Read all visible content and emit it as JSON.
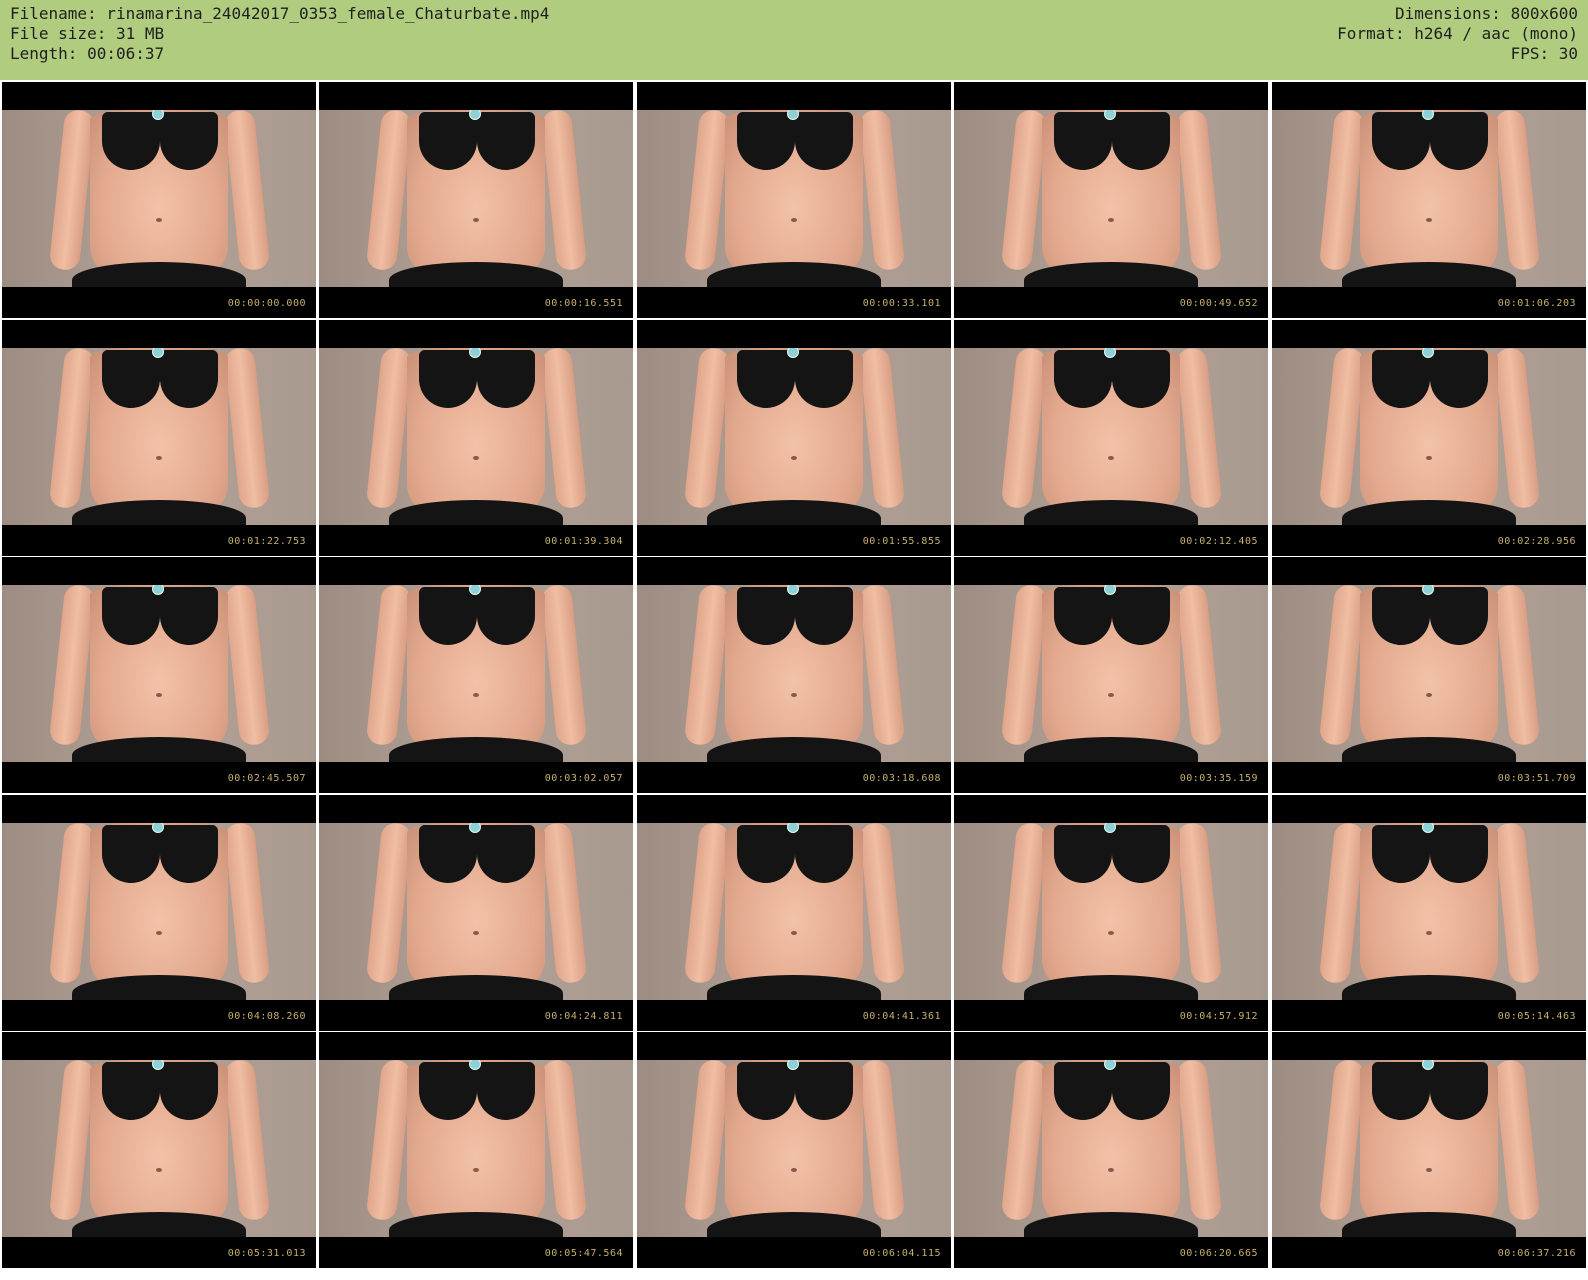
{
  "header": {
    "filename": "Filename: rinamarina_24042017_0353_female_Chaturbate.mp4",
    "filesize": "File size: 31 MB",
    "length": "Length: 00:06:37",
    "dimensions": "Dimensions: 800x600",
    "format": "Format: h264 / aac (mono)",
    "fps": "FPS: 30"
  },
  "colors": {
    "header_bg": "#b0cc7e",
    "timestamp": "#c7b06c"
  },
  "thumbnails": [
    {
      "timestamp": "00:00:00.000"
    },
    {
      "timestamp": "00:00:16.551"
    },
    {
      "timestamp": "00:00:33.101"
    },
    {
      "timestamp": "00:00:49.652"
    },
    {
      "timestamp": "00:01:06.203"
    },
    {
      "timestamp": "00:01:22.753"
    },
    {
      "timestamp": "00:01:39.304"
    },
    {
      "timestamp": "00:01:55.855"
    },
    {
      "timestamp": "00:02:12.405"
    },
    {
      "timestamp": "00:02:28.956"
    },
    {
      "timestamp": "00:02:45.507"
    },
    {
      "timestamp": "00:03:02.057"
    },
    {
      "timestamp": "00:03:18.608"
    },
    {
      "timestamp": "00:03:35.159"
    },
    {
      "timestamp": "00:03:51.709"
    },
    {
      "timestamp": "00:04:08.260"
    },
    {
      "timestamp": "00:04:24.811"
    },
    {
      "timestamp": "00:04:41.361"
    },
    {
      "timestamp": "00:04:57.912"
    },
    {
      "timestamp": "00:05:14.463"
    },
    {
      "timestamp": "00:05:31.013"
    },
    {
      "timestamp": "00:05:47.564"
    },
    {
      "timestamp": "00:06:04.115"
    },
    {
      "timestamp": "00:06:20.665"
    },
    {
      "timestamp": "00:06:37.216"
    }
  ]
}
